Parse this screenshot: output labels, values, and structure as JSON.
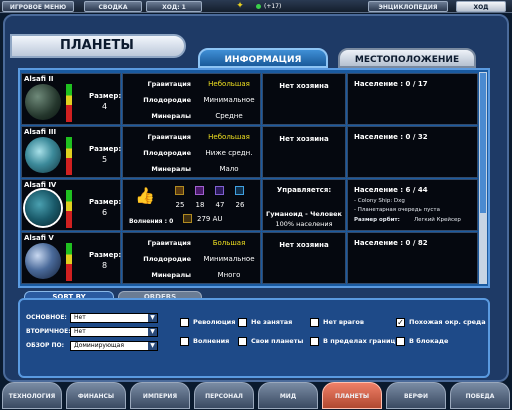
{
  "topbar": {
    "menu": "ИГРОВОЕ МЕНЮ",
    "summary": "СВОДКА",
    "turn": "ХОД: 1",
    "credits": "(+17)",
    "encyclopedia": "ЭНЦИКЛОПЕДИЯ",
    "turn_button": "ХОД"
  },
  "header": {
    "title": "ПЛАНЕТЫ"
  },
  "tabs": {
    "info": "ИНФОРМАЦИЯ",
    "location": "МЕСТОПОЛОЖЕНИЕ"
  },
  "labels": {
    "size": "Размер:",
    "gravity": "Гравитация",
    "fertility": "Плодородие",
    "minerals": "Минералы"
  },
  "planets": [
    {
      "name": "Alsafi II",
      "size": "4",
      "gravity": "Небольшая",
      "fertility": "Минимальное",
      "minerals": "Средне",
      "owner": "Нет хозяина",
      "population": "Население : 0 / 17"
    },
    {
      "name": "Alsafi III",
      "size": "5",
      "gravity": "Небольшая",
      "fertility": "Ниже средн.",
      "minerals": "Мало",
      "owner": "Нет хозяина",
      "population": "Население : 0 / 32"
    },
    {
      "name": "Alsafi IV",
      "size": "6",
      "owned": true,
      "unrest": "Волнения : 0",
      "stats": [
        "25",
        "18",
        "47",
        "26"
      ],
      "au": "279 AU",
      "governor_label": "Управляется:",
      "governor": "Гуманоид - Человек",
      "governor_pct": "100% населения",
      "population": "Население : 6 / 44",
      "notes": [
        "- Colony Ship: Dxg",
        "- Планетарная очередь пуста"
      ],
      "orbit_label": "Размер орбит:",
      "orbit": "Легкий Крейсер"
    },
    {
      "name": "Alsafi V",
      "size": "8",
      "gravity": "Большая",
      "fertility": "Минимальное",
      "minerals": "Много",
      "owner": "Нет хозяина",
      "population": "Население : 0 / 82"
    }
  ],
  "sort": {
    "tab_sort": "SORT BY",
    "tab_orders": "ORDERS",
    "primary_label": "ОСНОВНОЕ:",
    "primary_value": "Нет",
    "secondary_label": "ВТОРИЧНОЕ:",
    "secondary_value": "Нет",
    "view_label": "ОБЗОР ПО:",
    "view_value": "Доминирующая",
    "checks": [
      {
        "label": "Революция",
        "checked": false
      },
      {
        "label": "Не занятая",
        "checked": false
      },
      {
        "label": "Нет врагов",
        "checked": false
      },
      {
        "label": "Похожая окр. среда",
        "checked": true
      },
      {
        "label": "Волнения",
        "checked": false
      },
      {
        "label": "Свои планеты",
        "checked": false
      },
      {
        "label": "В пределах границ",
        "checked": false
      },
      {
        "label": "В блокаде",
        "checked": false
      }
    ]
  },
  "bottom_tabs": [
    "ТЕХНОЛОГИЯ",
    "ФИНАНСЫ",
    "ИМПЕРИЯ",
    "ПЕРСОНАЛ",
    "МИД",
    "ПЛАНЕТЫ",
    "ВЕРФИ",
    "ПОБЕДА"
  ],
  "active_tab": "ПЛАНЕТЫ"
}
